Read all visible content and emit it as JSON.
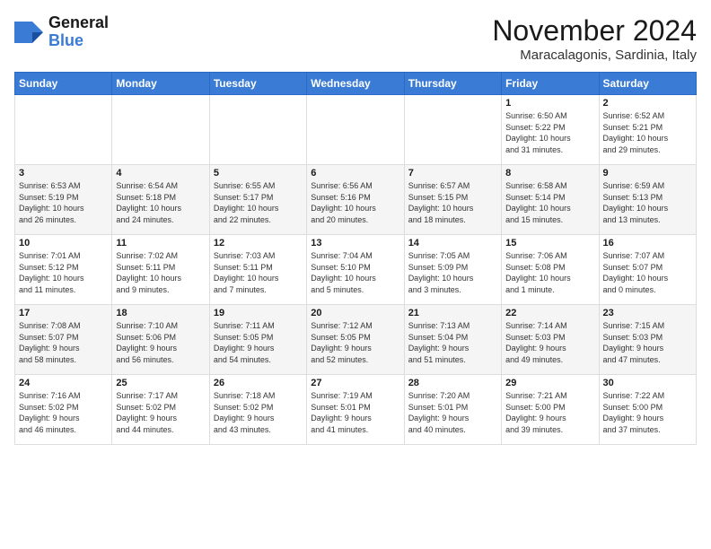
{
  "header": {
    "logo_line1": "General",
    "logo_line2": "Blue",
    "month_title": "November 2024",
    "location": "Maracalagonis, Sardinia, Italy"
  },
  "weekdays": [
    "Sunday",
    "Monday",
    "Tuesday",
    "Wednesday",
    "Thursday",
    "Friday",
    "Saturday"
  ],
  "weeks": [
    [
      {
        "day": "",
        "info": ""
      },
      {
        "day": "",
        "info": ""
      },
      {
        "day": "",
        "info": ""
      },
      {
        "day": "",
        "info": ""
      },
      {
        "day": "",
        "info": ""
      },
      {
        "day": "1",
        "info": "Sunrise: 6:50 AM\nSunset: 5:22 PM\nDaylight: 10 hours\nand 31 minutes."
      },
      {
        "day": "2",
        "info": "Sunrise: 6:52 AM\nSunset: 5:21 PM\nDaylight: 10 hours\nand 29 minutes."
      }
    ],
    [
      {
        "day": "3",
        "info": "Sunrise: 6:53 AM\nSunset: 5:19 PM\nDaylight: 10 hours\nand 26 minutes."
      },
      {
        "day": "4",
        "info": "Sunrise: 6:54 AM\nSunset: 5:18 PM\nDaylight: 10 hours\nand 24 minutes."
      },
      {
        "day": "5",
        "info": "Sunrise: 6:55 AM\nSunset: 5:17 PM\nDaylight: 10 hours\nand 22 minutes."
      },
      {
        "day": "6",
        "info": "Sunrise: 6:56 AM\nSunset: 5:16 PM\nDaylight: 10 hours\nand 20 minutes."
      },
      {
        "day": "7",
        "info": "Sunrise: 6:57 AM\nSunset: 5:15 PM\nDaylight: 10 hours\nand 18 minutes."
      },
      {
        "day": "8",
        "info": "Sunrise: 6:58 AM\nSunset: 5:14 PM\nDaylight: 10 hours\nand 15 minutes."
      },
      {
        "day": "9",
        "info": "Sunrise: 6:59 AM\nSunset: 5:13 PM\nDaylight: 10 hours\nand 13 minutes."
      }
    ],
    [
      {
        "day": "10",
        "info": "Sunrise: 7:01 AM\nSunset: 5:12 PM\nDaylight: 10 hours\nand 11 minutes."
      },
      {
        "day": "11",
        "info": "Sunrise: 7:02 AM\nSunset: 5:11 PM\nDaylight: 10 hours\nand 9 minutes."
      },
      {
        "day": "12",
        "info": "Sunrise: 7:03 AM\nSunset: 5:11 PM\nDaylight: 10 hours\nand 7 minutes."
      },
      {
        "day": "13",
        "info": "Sunrise: 7:04 AM\nSunset: 5:10 PM\nDaylight: 10 hours\nand 5 minutes."
      },
      {
        "day": "14",
        "info": "Sunrise: 7:05 AM\nSunset: 5:09 PM\nDaylight: 10 hours\nand 3 minutes."
      },
      {
        "day": "15",
        "info": "Sunrise: 7:06 AM\nSunset: 5:08 PM\nDaylight: 10 hours\nand 1 minute."
      },
      {
        "day": "16",
        "info": "Sunrise: 7:07 AM\nSunset: 5:07 PM\nDaylight: 10 hours\nand 0 minutes."
      }
    ],
    [
      {
        "day": "17",
        "info": "Sunrise: 7:08 AM\nSunset: 5:07 PM\nDaylight: 9 hours\nand 58 minutes."
      },
      {
        "day": "18",
        "info": "Sunrise: 7:10 AM\nSunset: 5:06 PM\nDaylight: 9 hours\nand 56 minutes."
      },
      {
        "day": "19",
        "info": "Sunrise: 7:11 AM\nSunset: 5:05 PM\nDaylight: 9 hours\nand 54 minutes."
      },
      {
        "day": "20",
        "info": "Sunrise: 7:12 AM\nSunset: 5:05 PM\nDaylight: 9 hours\nand 52 minutes."
      },
      {
        "day": "21",
        "info": "Sunrise: 7:13 AM\nSunset: 5:04 PM\nDaylight: 9 hours\nand 51 minutes."
      },
      {
        "day": "22",
        "info": "Sunrise: 7:14 AM\nSunset: 5:03 PM\nDaylight: 9 hours\nand 49 minutes."
      },
      {
        "day": "23",
        "info": "Sunrise: 7:15 AM\nSunset: 5:03 PM\nDaylight: 9 hours\nand 47 minutes."
      }
    ],
    [
      {
        "day": "24",
        "info": "Sunrise: 7:16 AM\nSunset: 5:02 PM\nDaylight: 9 hours\nand 46 minutes."
      },
      {
        "day": "25",
        "info": "Sunrise: 7:17 AM\nSunset: 5:02 PM\nDaylight: 9 hours\nand 44 minutes."
      },
      {
        "day": "26",
        "info": "Sunrise: 7:18 AM\nSunset: 5:02 PM\nDaylight: 9 hours\nand 43 minutes."
      },
      {
        "day": "27",
        "info": "Sunrise: 7:19 AM\nSunset: 5:01 PM\nDaylight: 9 hours\nand 41 minutes."
      },
      {
        "day": "28",
        "info": "Sunrise: 7:20 AM\nSunset: 5:01 PM\nDaylight: 9 hours\nand 40 minutes."
      },
      {
        "day": "29",
        "info": "Sunrise: 7:21 AM\nSunset: 5:00 PM\nDaylight: 9 hours\nand 39 minutes."
      },
      {
        "day": "30",
        "info": "Sunrise: 7:22 AM\nSunset: 5:00 PM\nDaylight: 9 hours\nand 37 minutes."
      }
    ]
  ]
}
